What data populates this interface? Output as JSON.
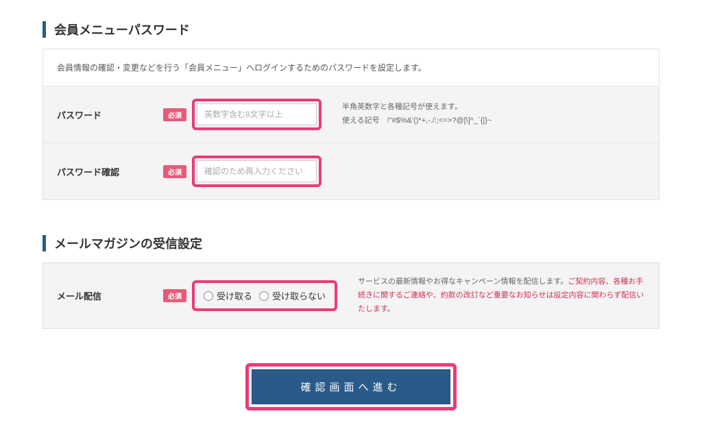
{
  "sections": {
    "password": {
      "title": "会員メニューパスワード",
      "description": "会員情報の確認・変更などを行う「会員メニュー」へログインするためのパスワードを設定します。",
      "rows": {
        "password": {
          "label": "パスワード",
          "required": "必須",
          "placeholder": "英数字含む8文字以上",
          "help_line1": "半角英数字と各種記号が使えます。",
          "help_line2": "使える記号　!\"#$%&'()*+,-./:;<=>?@[\\]^_`{|}~"
        },
        "password_confirm": {
          "label": "パスワード確認",
          "required": "必須",
          "placeholder": "確認のため再入力ください"
        }
      }
    },
    "mail": {
      "title": "メールマガジンの受信設定",
      "rows": {
        "delivery": {
          "label": "メール配信",
          "required": "必須",
          "option_receive": "受け取る",
          "option_not_receive": "受け取らない",
          "help_text1": "サービスの最新情報やお得なキャンペーン情報を配信します。",
          "help_text2": "ご契約内容、各種お手続きに関するご連絡や、約款の改訂など重要なお知らせは設定内容に関わらず配信いたします。"
        }
      }
    }
  },
  "submit": {
    "label": "確認画面へ進む"
  }
}
